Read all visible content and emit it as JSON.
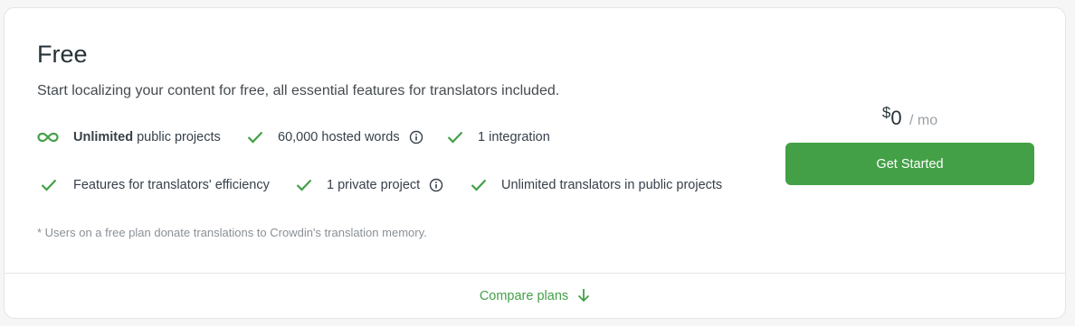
{
  "plan": {
    "title": "Free",
    "description": "Start localizing your content for free, all essential features for translators included.",
    "note": "* Users on a free plan donate translations to Crowdin's translation memory."
  },
  "features": {
    "unlimited_public": {
      "bold": "Unlimited",
      "text": "public projects",
      "icon": "infinity-icon"
    },
    "hosted_words": {
      "text": "60,000 hosted words",
      "icon": "check-icon",
      "info": true
    },
    "integration": {
      "text": "1 integration",
      "icon": "check-icon"
    },
    "translator_efficiency": {
      "text": "Features for translators' efficiency",
      "icon": "check-icon"
    },
    "private_project": {
      "text": "1 private project",
      "icon": "check-icon",
      "info": true
    },
    "unlimited_translators": {
      "text": "Unlimited translators in public projects",
      "icon": "check-icon"
    }
  },
  "pricing": {
    "currency": "$",
    "amount": "0",
    "period": "/ mo",
    "cta_label": "Get Started"
  },
  "footer": {
    "compare_label": "Compare plans",
    "compare_icon": "arrow-down-icon"
  },
  "colors": {
    "accent": "#43a047",
    "text": "#263238",
    "muted": "#8a9096"
  }
}
